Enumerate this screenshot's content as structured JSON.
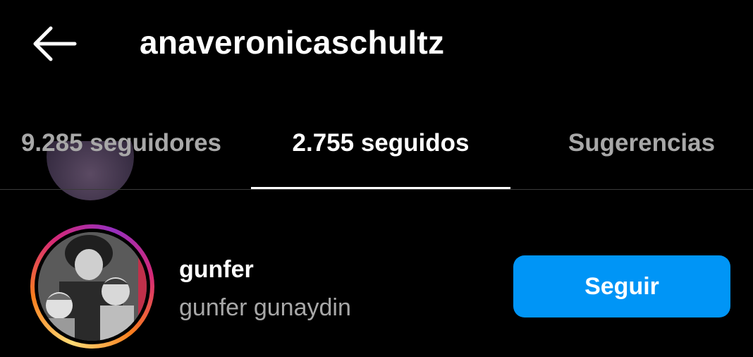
{
  "header": {
    "back_icon": "arrow-left-icon",
    "title": "anaveronicaschultz"
  },
  "tabs": [
    {
      "label": "9.285 seguidores",
      "active": false
    },
    {
      "label": "2.755 seguidos",
      "active": true
    },
    {
      "label": "Sugerencias",
      "active": false
    }
  ],
  "list": {
    "items": [
      {
        "username": "gunfer",
        "full_name": "gunfer gunaydin",
        "story_ring": true,
        "action_label": "Seguir"
      }
    ]
  },
  "colors": {
    "background": "#000000",
    "primary_text": "#ffffff",
    "secondary_text": "#a8a8a8",
    "accent": "#0095f6",
    "divider": "#3a3a3a"
  }
}
